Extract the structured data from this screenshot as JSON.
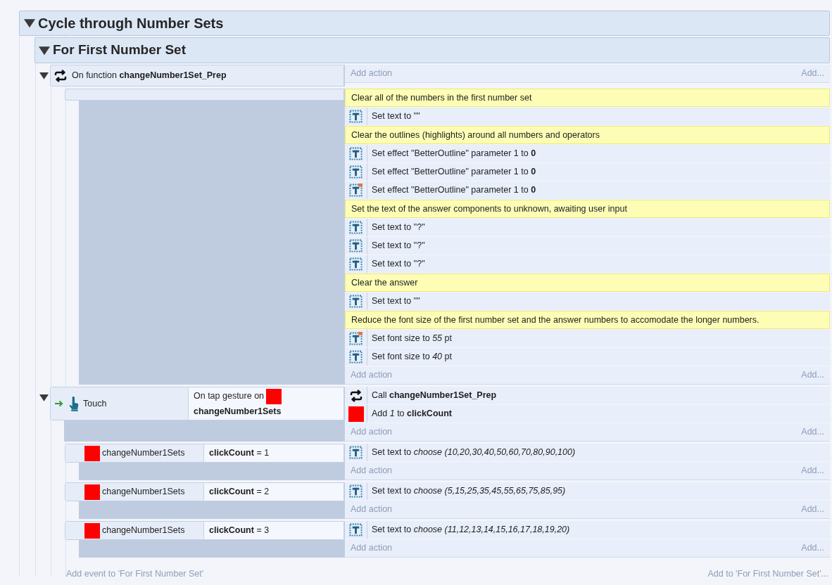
{
  "group": {
    "title": "Cycle through Number Sets",
    "expanded": true,
    "subgroup": {
      "title": "For First Number Set",
      "expanded": true,
      "events": [
        {
          "expanded": true,
          "conditions": [
            {
              "kind": "function",
              "text": "On function **changeNumber1Set_Prep**"
            }
          ],
          "add_action": "Add action",
          "add_more": "Add...",
          "children": [
            {
              "add_action": "Add action",
              "add_more": "Add...",
              "actions": [
                {
                  "kind": "comment",
                  "text": "Clear all of the numbers in the first number set"
                },
                {
                  "kind": "text",
                  "text": "Set text to \"\""
                },
                {
                  "kind": "comment",
                  "text": "Clear the outlines (highlights) around all numbers and operators"
                },
                {
                  "kind": "text",
                  "text": "Set effect \"BetterOutline\" parameter 1 to **0**"
                },
                {
                  "kind": "text",
                  "text": "Set effect \"BetterOutline\" parameter 1 to **0**"
                },
                {
                  "kind": "text_alt",
                  "text": "Set effect \"BetterOutline\" parameter 1 to **0**"
                },
                {
                  "kind": "comment",
                  "text": "Set the text of the answer components to unknown, awaiting user input"
                },
                {
                  "kind": "text",
                  "text": "Set text to \"?\""
                },
                {
                  "kind": "text",
                  "text": "Set text to \"?\""
                },
                {
                  "kind": "text",
                  "text": "Set text to \"?\""
                },
                {
                  "kind": "comment",
                  "text": "Clear the answer"
                },
                {
                  "kind": "text",
                  "text": "Set text to \"\""
                },
                {
                  "kind": "comment",
                  "text": "Reduce the font size of the first number set and the answer numbers to accomodate the longer numbers."
                },
                {
                  "kind": "text_alt",
                  "text": "Set font size to *55* pt"
                },
                {
                  "kind": "text",
                  "text": "Set font size to *40* pt"
                }
              ]
            }
          ]
        },
        {
          "expanded": true,
          "conditions": [
            {
              "kind": "trigger",
              "object": "Touch",
              "text": "On tap gesture on",
              "target": "changeNumber1Sets"
            }
          ],
          "add_action": "Add action",
          "add_more": "Add...",
          "actions": [
            {
              "kind": "function",
              "text": "Call **changeNumber1Set_Prep**"
            },
            {
              "kind": "sprite",
              "text": "Add *1* to **clickCount**"
            }
          ],
          "children": [
            {
              "conditions": [
                {
                  "kind": "compare",
                  "object": "changeNumber1Sets",
                  "text": "**clickCount** = 1"
                }
              ],
              "add_action": "Add action",
              "add_more": "Add...",
              "actions": [
                {
                  "kind": "text",
                  "text": "Set text to *choose (10,20,30,40,50,60,70,80,90,100)*"
                }
              ]
            },
            {
              "conditions": [
                {
                  "kind": "compare",
                  "object": "changeNumber1Sets",
                  "text": "**clickCount** = 2"
                }
              ],
              "add_action": "Add action",
              "add_more": "Add...",
              "actions": [
                {
                  "kind": "text",
                  "text": "Set text to *choose (5,15,25,35,45,55,65,75,85,95)*"
                }
              ]
            },
            {
              "conditions": [
                {
                  "kind": "compare",
                  "object": "changeNumber1Sets",
                  "text": "**clickCount** = 3"
                }
              ],
              "add_action": "Add action",
              "add_more": "Add...",
              "actions": [
                {
                  "kind": "text",
                  "text": "Set text to *choose (11,12,13,14,15,16,17,18,19,20)*"
                }
              ]
            }
          ]
        }
      ],
      "add_event": "Add event to 'For First Number Set'",
      "add_to": "Add to 'For First Number Set'..."
    }
  }
}
